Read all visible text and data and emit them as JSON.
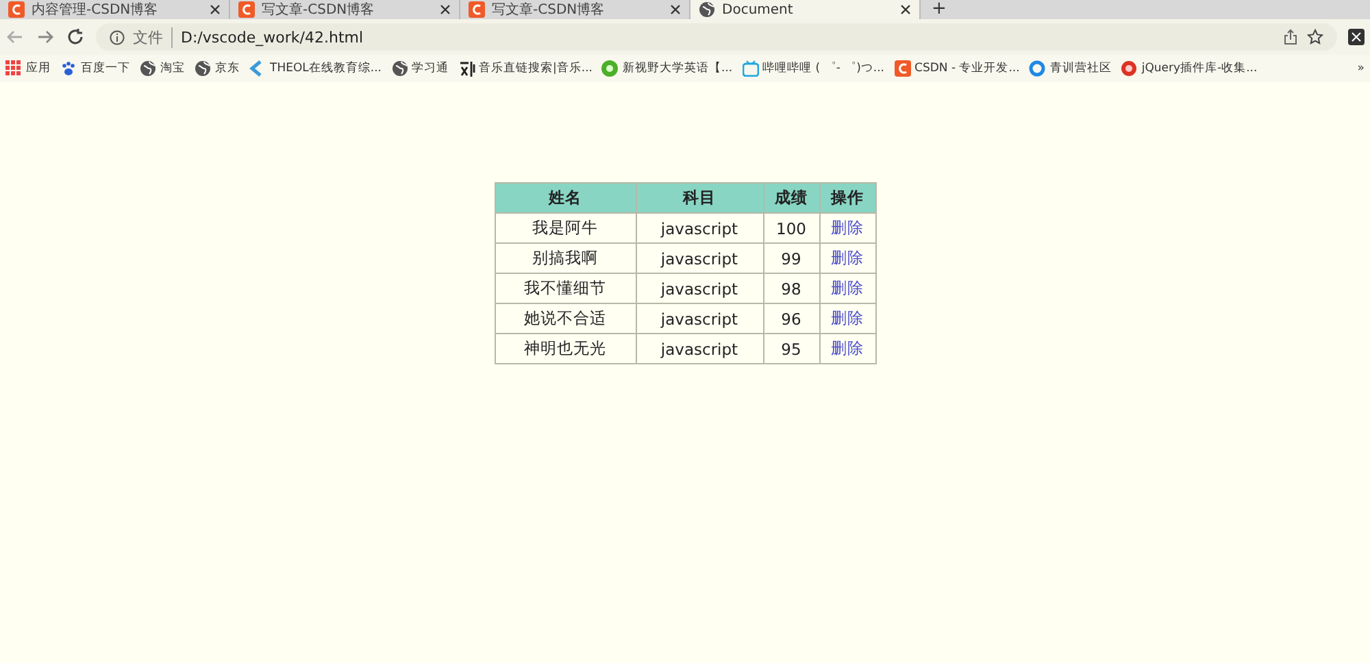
{
  "tabs": [
    {
      "title": "内容管理-CSDN博客",
      "kind": "csdn",
      "selected": false
    },
    {
      "title": "写文章-CSDN博客",
      "kind": "csdn",
      "selected": false
    },
    {
      "title": "写文章-CSDN博客",
      "kind": "csdn",
      "selected": false
    },
    {
      "title": "Document",
      "kind": "globe",
      "selected": true
    }
  ],
  "new_tab": "+",
  "address_bar": {
    "scheme_label": "文件",
    "url": "D:/vscode_work/42.html"
  },
  "bookmarks": [
    {
      "label": "应用",
      "kind": "apps"
    },
    {
      "label": "百度一下",
      "kind": "paw"
    },
    {
      "label": "淘宝",
      "kind": "globe"
    },
    {
      "label": "京东",
      "kind": "globe"
    },
    {
      "label": "THEOL在线教育综...",
      "kind": "check"
    },
    {
      "label": "学习通",
      "kind": "globe"
    },
    {
      "label": "音乐直链搜索|音乐...",
      "kind": "glyph"
    },
    {
      "label": "新视野大学英语【...",
      "kind": "leaf"
    },
    {
      "label": "哔哩哔哩 ( ゜- ゜)つ...",
      "kind": "tv"
    },
    {
      "label": "CSDN - 专业开发...",
      "kind": "csdn"
    },
    {
      "label": "青训营社区",
      "kind": "ring"
    },
    {
      "label": "jQuery插件库-收集...",
      "kind": "target"
    }
  ],
  "bookmark_overflow": "»",
  "table": {
    "columns": [
      "姓名",
      "科目",
      "成绩",
      "操作"
    ],
    "rows": [
      {
        "name": "我是阿牛",
        "subject": "javascript",
        "score": "100",
        "action": "删除"
      },
      {
        "name": "别搞我啊",
        "subject": "javascript",
        "score": "99",
        "action": "删除"
      },
      {
        "name": "我不懂细节",
        "subject": "javascript",
        "score": "98",
        "action": "删除"
      },
      {
        "name": "她说不合适",
        "subject": "javascript",
        "score": "96",
        "action": "删除"
      },
      {
        "name": "神明也无光",
        "subject": "javascript",
        "score": "95",
        "action": "删除"
      }
    ]
  }
}
